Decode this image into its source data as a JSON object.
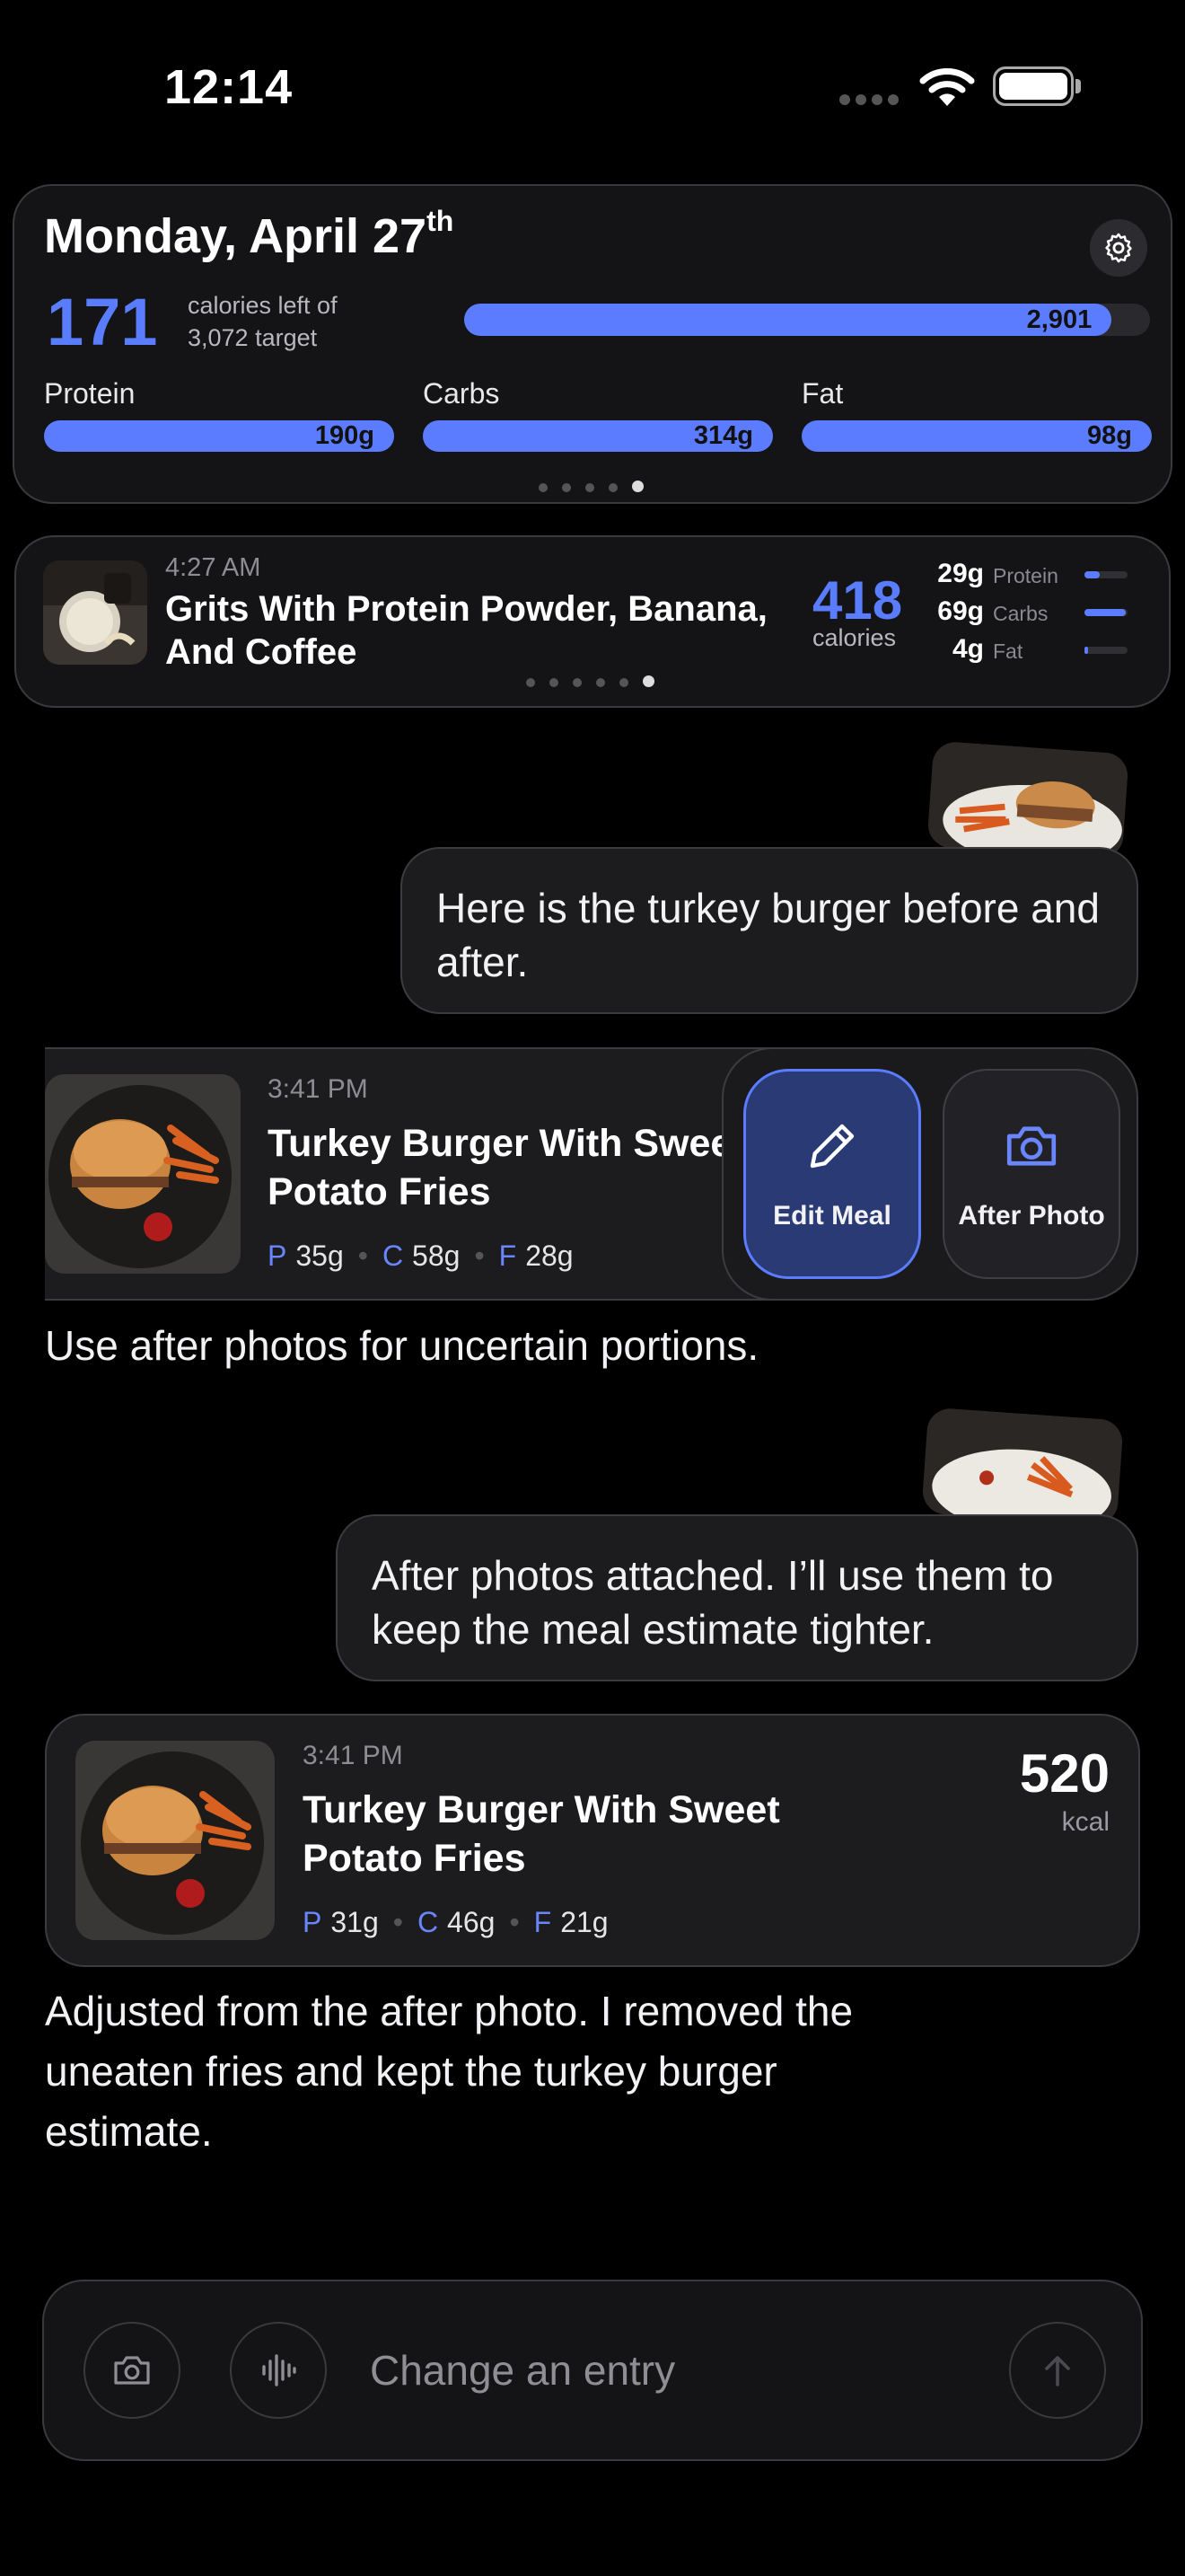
{
  "status_bar": {
    "time": "12:14"
  },
  "summary": {
    "date": "Monday, April 27",
    "date_suffix": "th",
    "calories_left": "171",
    "calories_left_label_1": "calories left of",
    "calories_left_label_2": "3,072 target",
    "calories_eaten": "2,901",
    "calories_progress": 0.944,
    "macros": [
      {
        "label": "Protein",
        "value": "190g"
      },
      {
        "label": "Carbs",
        "value": "314g"
      },
      {
        "label": "Fat",
        "value": "98g"
      }
    ],
    "page_count": 5,
    "page_active": 5
  },
  "meal_strip": {
    "time": "4:27 AM",
    "title": "Grits With Protein Powder, Banana, And Coffee",
    "calories": "418",
    "calories_label": "calories",
    "macros": [
      {
        "value": "29g",
        "name": "Protein",
        "fill": 0.35
      },
      {
        "value": "69g",
        "name": "Carbs",
        "fill": 0.95
      },
      {
        "value": "4g",
        "name": "Fat",
        "fill": 0.08
      }
    ],
    "page_count": 6,
    "page_active": 6
  },
  "chat": {
    "user_message_1": "Here is the turkey burger before and after.",
    "meal_card_1": {
      "time": "3:41 PM",
      "title_line1": "Turkey Burger With Swee",
      "title_line2": "Potato Fries",
      "protein": "35g",
      "carbs": "58g",
      "fat": "28g",
      "edit_label": "Edit Meal",
      "after_label": "After Photo"
    },
    "assistant_message_1": "Use after photos for uncertain portions.",
    "user_message_2": "After photos attached. I’ll use them to keep the meal estimate tighter.",
    "meal_card_2": {
      "time": "3:41 PM",
      "title": "Turkey Burger With Sweet Potato Fries",
      "protein": "31g",
      "carbs": "46g",
      "fat": "21g",
      "kcal": "520",
      "kcal_unit": "kcal"
    },
    "assistant_message_2": "Adjusted from the after photo. I removed the uneaten fries and kept the turkey burger estimate."
  },
  "macro_keys": {
    "p": "P",
    "c": "C",
    "f": "F"
  },
  "input": {
    "placeholder": "Change an entry"
  },
  "colors": {
    "accent": "#5b7cff",
    "background": "#000000",
    "card": "#1c1c1f"
  }
}
